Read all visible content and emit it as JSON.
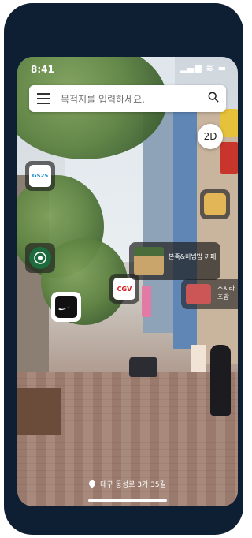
{
  "status_bar": {
    "time": "8:41",
    "icons": "▂▄▆ ≋ ▬"
  },
  "search": {
    "placeholder": "목적지를 입력하세요."
  },
  "view_toggle": {
    "label": "2D"
  },
  "markers": {
    "gs25": {
      "label": "GS25"
    },
    "starbucks": {
      "label": ""
    },
    "nike": {
      "label": ""
    },
    "cgv": {
      "label": "CGV"
    },
    "food": {
      "label": ""
    }
  },
  "place_card": {
    "name": "본죽&비빔밥 까페"
  },
  "place_card_2": {
    "name": "스시라\n초밥"
  },
  "location": {
    "address": "대구 동성로 3가 35길"
  },
  "colors": {
    "frame": "#0f1f33",
    "accent": "#1a8cd0"
  }
}
